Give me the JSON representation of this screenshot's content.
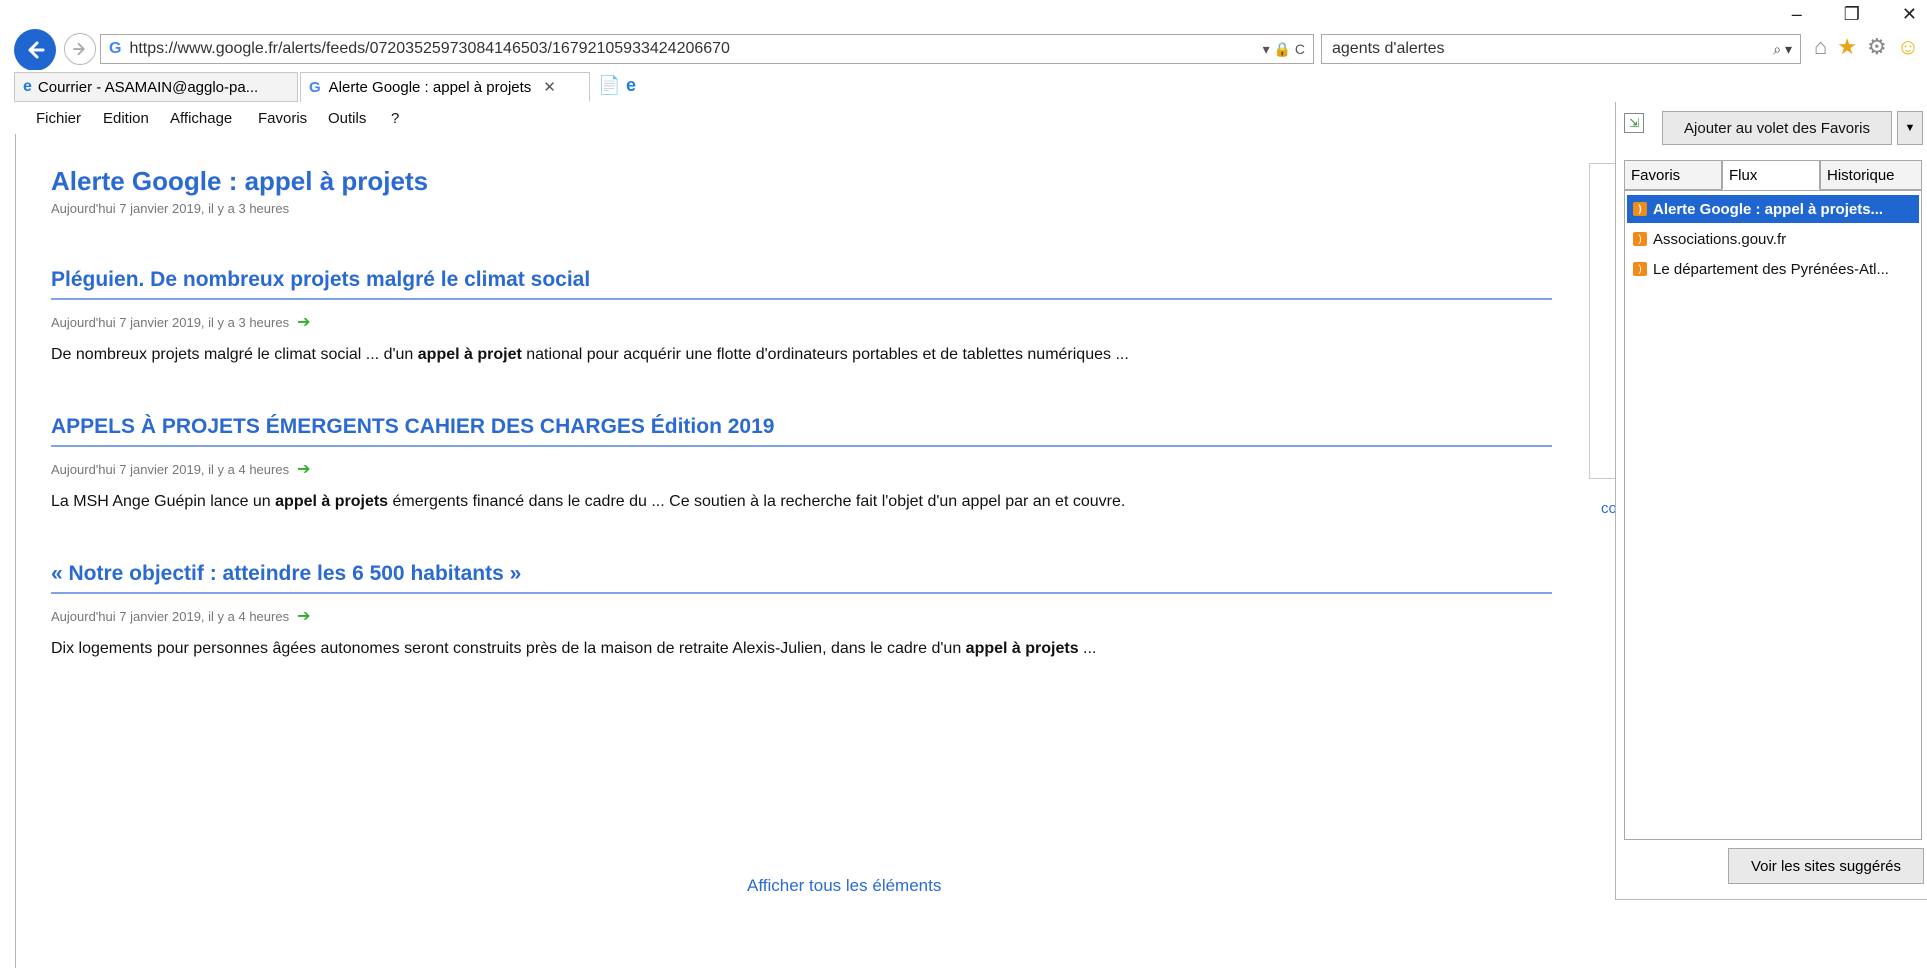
{
  "browser": {
    "url": "https://www.google.fr/alerts/feeds/07203525973084146503/16792105933424206670",
    "search_text": "agents d'alertes",
    "addr_tools": "▾ 🔒 C",
    "search_tools": "⌕ ▾"
  },
  "tabs": [
    {
      "label": "Courrier - ASAMAIN@agglo-pa..."
    },
    {
      "label": "Alerte Google : appel à projets"
    }
  ],
  "menu": [
    "Fichier",
    "Edition",
    "Affichage",
    "Favoris",
    "Outils",
    "?"
  ],
  "feed": {
    "title": "Alerte Google : appel à projets",
    "subtitle": "Aujourd'hui 7 janvier 2019, il y a 3 heures",
    "items": [
      {
        "title": "Pléguien. De nombreux projets malgré le climat social",
        "date": "Aujourd'hui 7 janvier 2019, il y a 3 heures",
        "desc_before": "De nombreux projets malgré le climat social ... d'un ",
        "desc_bold": "appel à projet",
        "desc_after": " national pour acquérir une flotte d'ordinateurs portables et de tablettes numériques ..."
      },
      {
        "title": "APPELS À PROJETS ÉMERGENTS CAHIER DES CHARGES Édition 2019",
        "date": "Aujourd'hui 7 janvier 2019, il y a 4 heures",
        "desc_before": "La MSH Ange Guépin lance un ",
        "desc_bold": "appel à projets",
        "desc_after": " émergents financé dans le cadre du ... Ce soutien à la recherche fait l'objet d'un appel par an et couvre."
      },
      {
        "title": "« Notre objectif : atteindre les 6 500 habitants »",
        "date": "Aujourd'hui 7 janvier 2019, il y a 4 heures",
        "desc_before": "Dix logements pour personnes âgées autonomes seront construits près de la maison de retraite Alexis-Julien, dans le cadre d'un ",
        "desc_bold": "appel à projets",
        "desc_after": " ..."
      }
    ],
    "show_all": "Afficher tous les éléments"
  },
  "behind_text": "co",
  "favorites_panel": {
    "add_button": "Ajouter au volet des Favoris",
    "tabs": [
      "Favoris",
      "Flux",
      "Historique"
    ],
    "items": [
      {
        "label": "Alerte Google : appel à projets..."
      },
      {
        "label": "Associations.gouv.fr"
      },
      {
        "label": "Le département des Pyrénées-Atl..."
      }
    ],
    "suggest_button": "Voir les sites suggérés"
  },
  "colors": {
    "accent": "#1f66d1",
    "link": "#2b6bd1",
    "rss": "#f08b1a",
    "arrow": "#2db12d"
  }
}
